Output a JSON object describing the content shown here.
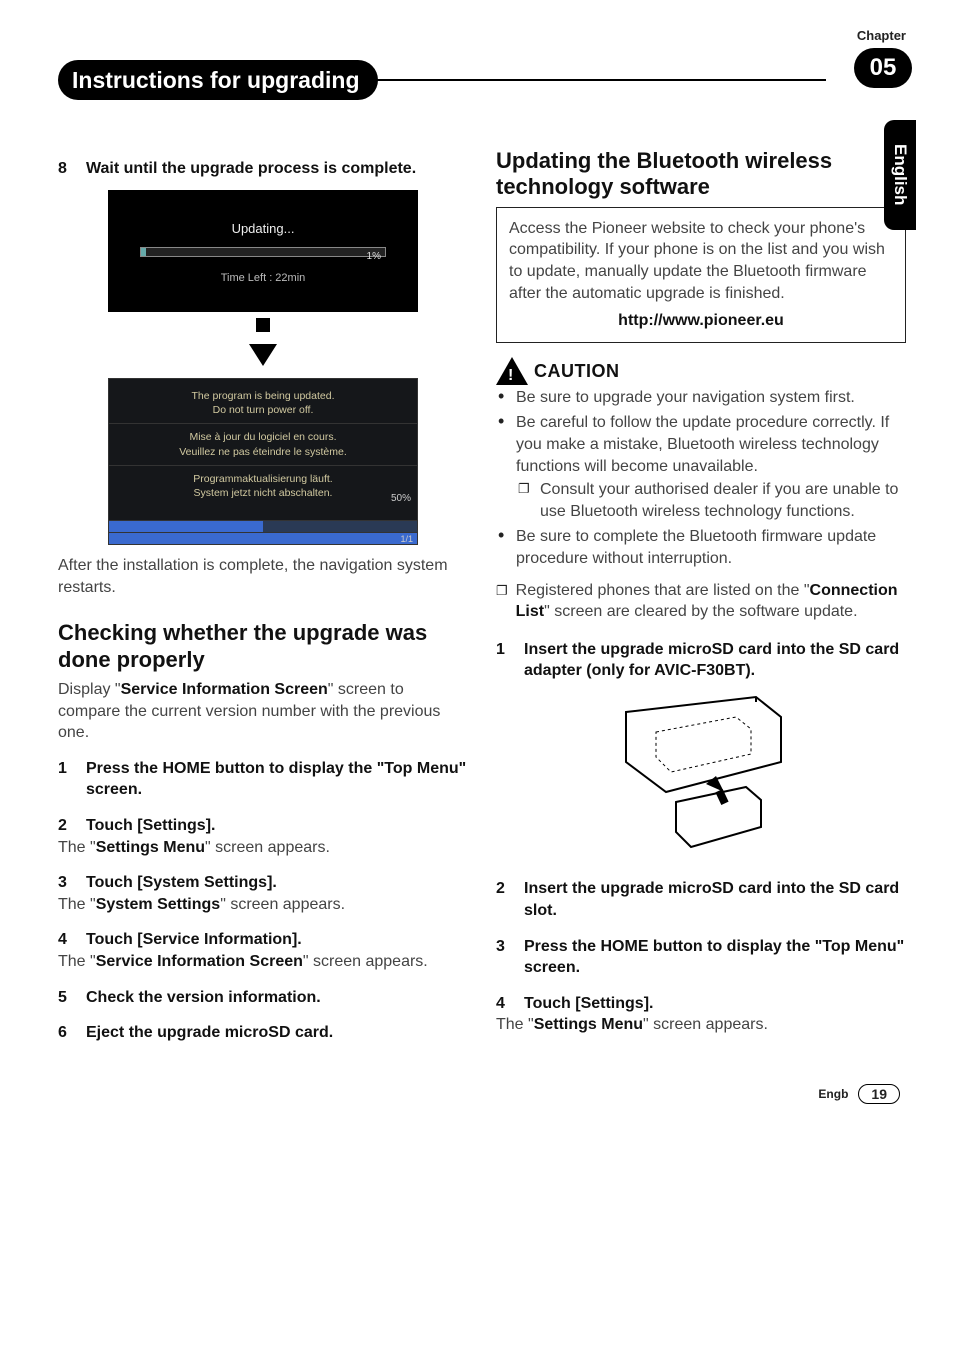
{
  "header": {
    "chapter_label": "Chapter",
    "chapter_number": "05",
    "title": "Instructions for upgrading",
    "language_tab": "English"
  },
  "left": {
    "step8_num": "8",
    "step8_text": "Wait until the upgrade process is complete.",
    "scr1": {
      "title": "Updating...",
      "percent": "1%",
      "time_left": "Time Left : 22min"
    },
    "scr2": {
      "line1a": "The program is being updated.",
      "line1b": "Do not turn power off.",
      "line2a": "Mise à jour du logiciel en cours.",
      "line2b": "Veuillez ne pas éteindre le système.",
      "line3a": "Programmaktualisierung läuft.",
      "line3b": "System jetzt nicht abschalten.",
      "pct": "50%",
      "count": "1/1"
    },
    "after_install": "After the installation is complete, the navigation system restarts.",
    "sub_heading": "Checking whether the upgrade was done properly",
    "intro_pre": "Display \"",
    "intro_bold": "Service Information Screen",
    "intro_post": "\" screen to compare the current version number with the previous one.",
    "steps": {
      "s1_num": "1",
      "s1": "Press the HOME button to display the \"Top Menu\" screen.",
      "s2_num": "2",
      "s2": "Touch [Settings].",
      "s2_body_pre": "The \"",
      "s2_body_bold": "Settings Menu",
      "s2_body_post": "\" screen appears.",
      "s3_num": "3",
      "s3": "Touch [System Settings].",
      "s3_body_pre": "The \"",
      "s3_body_bold": "System Settings",
      "s3_body_post": "\" screen appears.",
      "s4_num": "4",
      "s4": "Touch [Service Information].",
      "s4_body_pre": "The \"",
      "s4_body_bold": "Service Information Screen",
      "s4_body_post": "\" screen appears.",
      "s5_num": "5",
      "s5": "Check the version information.",
      "s6_num": "6",
      "s6": "Eject the upgrade microSD card."
    }
  },
  "right": {
    "sub_heading": "Updating the Bluetooth wireless technology software",
    "box_text": "Access the Pioneer website to check your phone's compatibility. If your phone is on the list and you wish to update, manually update the Bluetooth firmware after the automatic upgrade is finished.",
    "box_url": "http://www.pioneer.eu",
    "caution_label": "CAUTION",
    "bullets": {
      "b1": "Be sure to upgrade your navigation system first.",
      "b2": "Be careful to follow the update procedure correctly. If you make a mistake, Bluetooth wireless technology functions will become unavailable.",
      "b2_sub": "Consult your authorised dealer if you are unable to use Bluetooth wireless technology functions.",
      "b3": "Be sure to complete the Bluetooth firmware update procedure without interruption."
    },
    "note_pre": "Registered phones that are listed on the \"",
    "note_bold": "Connection List",
    "note_post": "\" screen are cleared by the software update.",
    "steps": {
      "s1_num": "1",
      "s1": "Insert the upgrade microSD card into the SD card adapter (only for AVIC-F30BT).",
      "s2_num": "2",
      "s2": "Insert the upgrade microSD card into the SD card slot.",
      "s3_num": "3",
      "s3": "Press the HOME button to display the \"Top Menu\" screen.",
      "s4_num": "4",
      "s4": "Touch [Settings].",
      "s4_body_pre": "The \"",
      "s4_body_bold": "Settings Menu",
      "s4_body_post": "\" screen appears."
    }
  },
  "footer": {
    "region": "Engb",
    "page": "19"
  }
}
